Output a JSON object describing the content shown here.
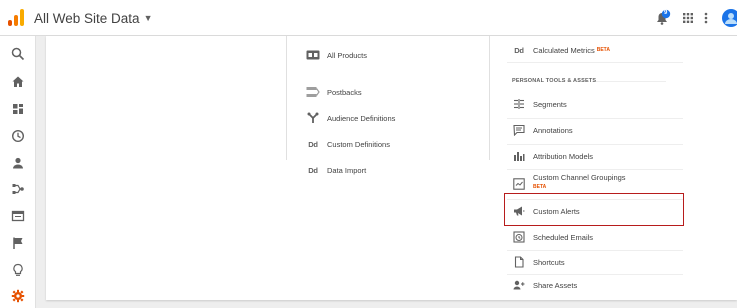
{
  "header": {
    "property_title": "All Web Site Data",
    "notification_count": "9",
    "icons": {
      "logo": "analytics-logo-icon",
      "caret": "caret-down-icon",
      "notifications": "bell-icon",
      "apps": "apps-grid-icon",
      "more": "more-vert-icon",
      "account": "avatar-icon"
    }
  },
  "rail": {
    "items": [
      {
        "name": "search-icon"
      },
      {
        "name": "home-icon"
      },
      {
        "name": "customization-icon"
      },
      {
        "name": "realtime-clock-icon"
      },
      {
        "name": "audience-person-icon"
      },
      {
        "name": "acquisition-icon"
      },
      {
        "name": "behavior-icon"
      },
      {
        "name": "conversions-flag-icon"
      },
      {
        "name": "discover-lightbulb-icon"
      },
      {
        "name": "admin-gear-icon"
      }
    ],
    "active_color": "#e65100"
  },
  "middle_column": {
    "items": [
      {
        "label": "All Products",
        "icon": "all-products-icon"
      },
      {
        "label": "Postbacks",
        "icon": "postbacks-icon"
      },
      {
        "label": "Audience Definitions",
        "icon": "audience-definitions-icon"
      },
      {
        "label": "Custom Definitions",
        "icon": "dd-icon",
        "icon_text": "Dd"
      },
      {
        "label": "Data Import",
        "icon": "dd-icon",
        "icon_text": "Dd"
      }
    ]
  },
  "right_column": {
    "top_item": {
      "label": "Calculated Metrics",
      "badge": "BETA",
      "icon_text": "Dd"
    },
    "section_title": "PERSONAL TOOLS & ASSETS",
    "items": [
      {
        "label": "Segments",
        "icon": "segments-icon"
      },
      {
        "label": "Annotations",
        "icon": "annotations-icon"
      },
      {
        "label": "Attribution Models",
        "icon": "attribution-models-icon"
      },
      {
        "label": "Custom Channel Groupings",
        "badge": "BETA",
        "icon": "channel-groupings-icon"
      },
      {
        "label": "Custom Alerts",
        "icon": "megaphone-icon"
      },
      {
        "label": "Scheduled Emails",
        "icon": "alarm-clock-icon"
      },
      {
        "label": "Shortcuts",
        "icon": "document-icon"
      },
      {
        "label": "Share Assets",
        "icon": "share-person-icon"
      }
    ]
  },
  "colors": {
    "accent": "#e65100",
    "highlight_border": "#b71c1c",
    "notification_blue": "#1a73e8"
  }
}
